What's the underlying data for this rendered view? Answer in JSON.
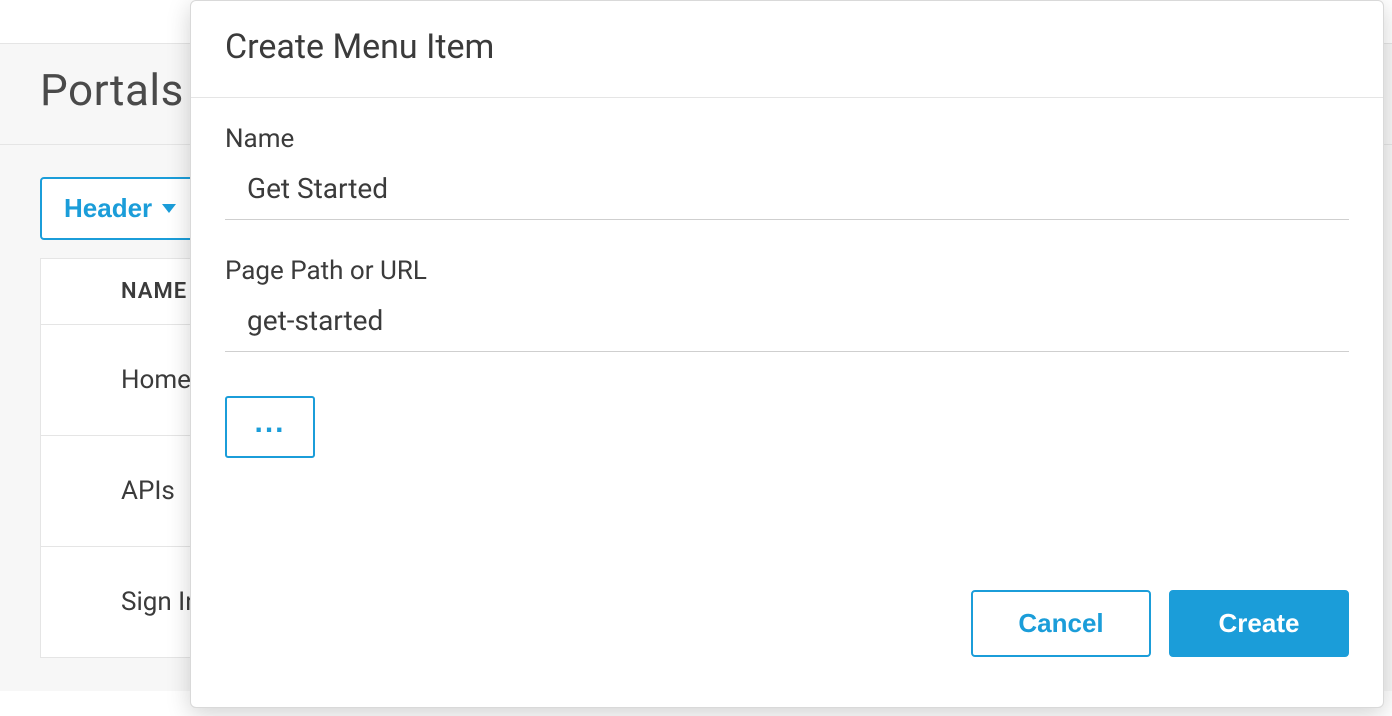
{
  "page": {
    "title": "Portals"
  },
  "toolbar": {
    "header_label": "Header"
  },
  "table": {
    "column_header": "NAME",
    "rows": [
      {
        "name": "Home"
      },
      {
        "name": "APIs"
      },
      {
        "name": "Sign In"
      }
    ]
  },
  "modal": {
    "title": "Create Menu Item",
    "fields": {
      "name_label": "Name",
      "name_value": "Get Started",
      "path_label": "Page Path or URL",
      "path_value": "get-started"
    },
    "more_label": "...",
    "cancel_label": "Cancel",
    "create_label": "Create"
  }
}
